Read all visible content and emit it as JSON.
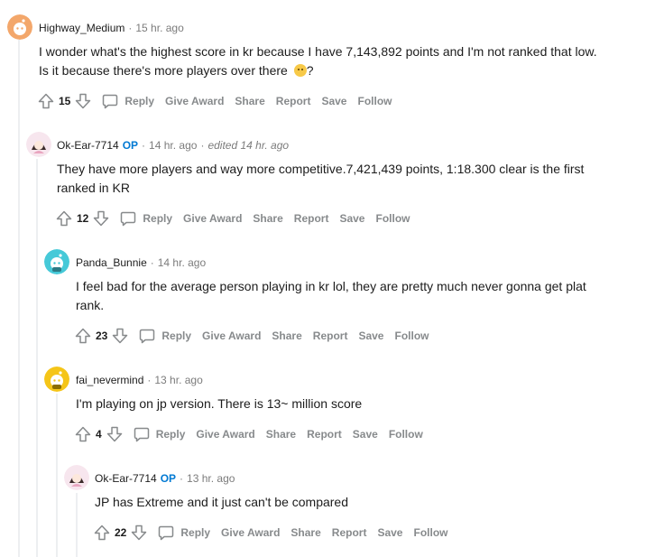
{
  "actions": {
    "reply": "Reply",
    "give_award": "Give Award",
    "share": "Share",
    "report": "Report",
    "save": "Save",
    "follow": "Follow"
  },
  "comments": [
    {
      "author": "Highway_Medium",
      "time": "15 hr. ago",
      "body_line1": "I wonder what's the highest score in kr because I have 7,143,892 points and I'm not ranked that low.",
      "body_line2": "Is it because there's more players over there",
      "body_tail": "?",
      "score": "15"
    },
    {
      "author": "Ok-Ear-7714",
      "op_badge": "OP",
      "time": "14 hr. ago",
      "edited": "edited 14 hr. ago",
      "body_line1": "They have more players and way more competitive.7,421,439 points, 1:18.300 clear is the first",
      "body_line2": "ranked in KR",
      "score": "12"
    },
    {
      "author": "Panda_Bunnie",
      "time": "14 hr. ago",
      "body_line1": "I feel bad for the average person playing in kr lol, they are pretty much never gonna get plat",
      "body_line2": "rank.",
      "score": "23"
    },
    {
      "author": "fai_nevermind",
      "time": "13 hr. ago",
      "body_line1": "I'm playing on jp version. There is 13~ million score",
      "score": "4"
    },
    {
      "author": "Ok-Ear-7714",
      "op_badge": "OP",
      "time": "13 hr. ago",
      "body_line1": "JP has Extreme and it just can't be compared",
      "score": "22"
    }
  ],
  "colors": {
    "op_accent": "#0079d3",
    "meta_gray": "#7c7c7c",
    "action_gray": "#878a8c",
    "thread_line": "#edeff1"
  },
  "icons": [
    "upvote-icon",
    "downvote-icon",
    "comment-bubble-icon",
    "snoo-avatar",
    "emoji-thinking-icon"
  ]
}
